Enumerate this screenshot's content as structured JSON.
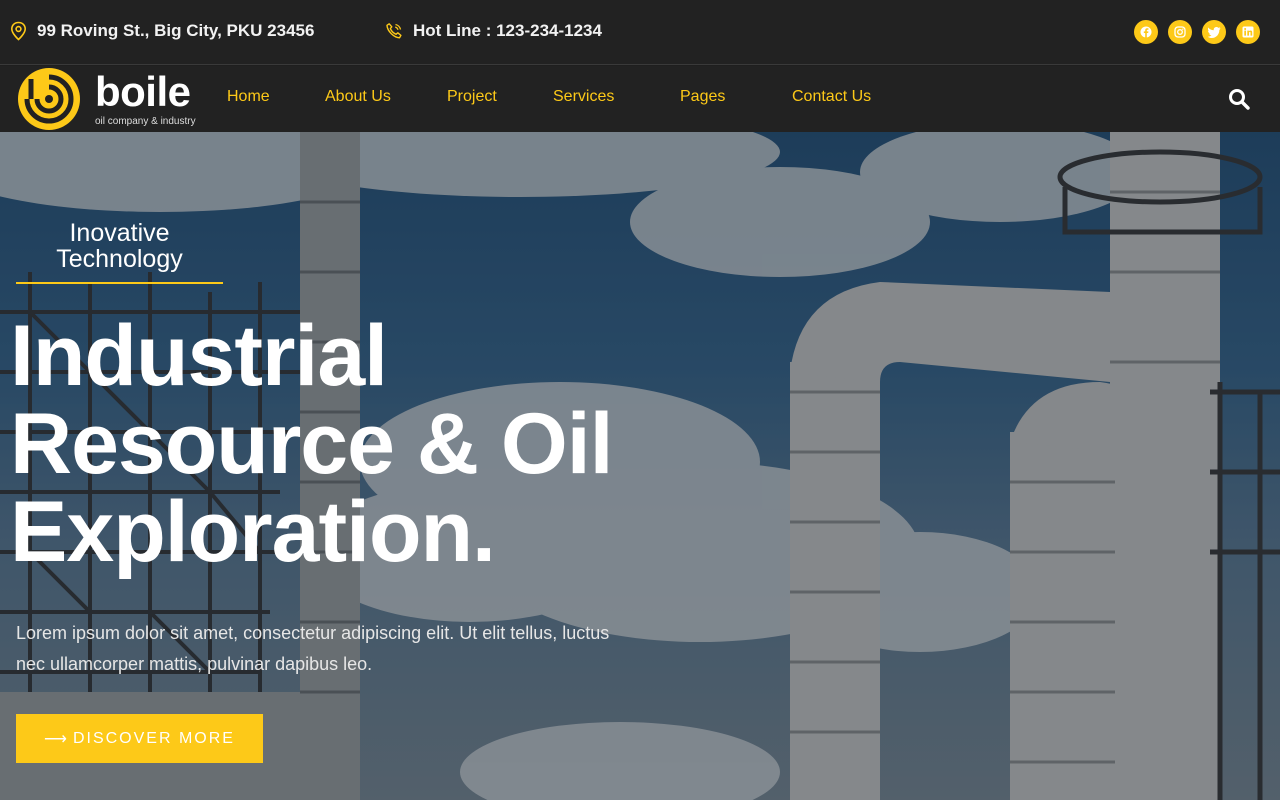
{
  "topbar": {
    "address": "99 Roving St., Big City, PKU 23456",
    "hotline": "Hot Line : 123-234-1234",
    "socials": [
      "facebook-icon",
      "instagram-icon",
      "twitter-icon",
      "linkedin-icon"
    ]
  },
  "brand": {
    "name": "boile",
    "tagline": "oil company & industry"
  },
  "nav": {
    "home": "Home",
    "about": "About Us",
    "project": "Project",
    "services": "Services",
    "pages": "Pages",
    "contact": "Contact Us"
  },
  "hero": {
    "eyebrow_line1": "Inovative",
    "eyebrow_line2": "Technology",
    "title_line1": "Industrial",
    "title_line2": "Resource & Oil",
    "title_line3": "Exploration.",
    "description": "Lorem ipsum dolor sit amet, consectetur adipiscing elit. Ut elit tellus, luctus nec ullamcorper mattis, pulvinar dapibus leo.",
    "cta_label": "DISCOVER MORE"
  },
  "colors": {
    "accent": "#fdc918",
    "bar_background": "#222222"
  }
}
